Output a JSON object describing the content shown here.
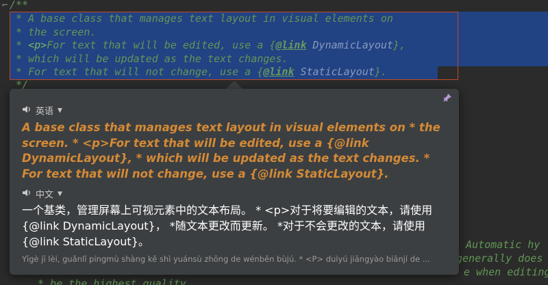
{
  "editor": {
    "line0": "/**",
    "line1": " * A base class that manages text layout in visual elements on",
    "line2": " * the screen.",
    "line3_pre": " * ",
    "line3_tag": "<p>",
    "line3_mid": "For text that will be edited, use a {",
    "line3_link": "@link",
    "line3_ref": " DynamicLayout",
    "line3_post": "},",
    "line4": " * which will be updated as the text changes.",
    "line5_pre": " * For text that will not change, use a {",
    "line5_link": "@link",
    "line5_ref": " StaticLayout",
    "line5_post": "}.",
    "line6": " */",
    "right1": "Automatic hy",
    "right2": "generally does",
    "right3": "e when editing",
    "bottom": " * be the highest quality"
  },
  "popup": {
    "source_lang": "英语",
    "target_lang": "中文",
    "source_text": "A base class that manages text layout in visual elements on * the screen. * <p>For text that will be edited, use a {@link DynamicLayout}, * which will be updated as the text changes. * For text that will not change, use a {@link StaticLayout}.",
    "translation": "一个基类，管理屏幕上可视元素中的文本布局。 * <p>对于将要编辑的文本，请使用{@link DynamicLayout}， *随文本更改而更新。 *对于不会更改的文本，请使用{@link StaticLayout}。",
    "pinyin": "Yīgè jī lèi, guǎnlǐ píngmù shàng kě shì yuánsù zhōng de wénběn bùjú. * <P> duìyú jiāngyào biānjí de ..."
  },
  "icons": {
    "speaker": "speaker-icon",
    "pin": "pin-icon",
    "caret": "chevron-down-icon"
  },
  "colors": {
    "editor_bg": "#2b2b2b",
    "comment": "#629755",
    "selection": "#214283",
    "popup_bg": "#3c3f41",
    "source_text": "#d48a36"
  }
}
